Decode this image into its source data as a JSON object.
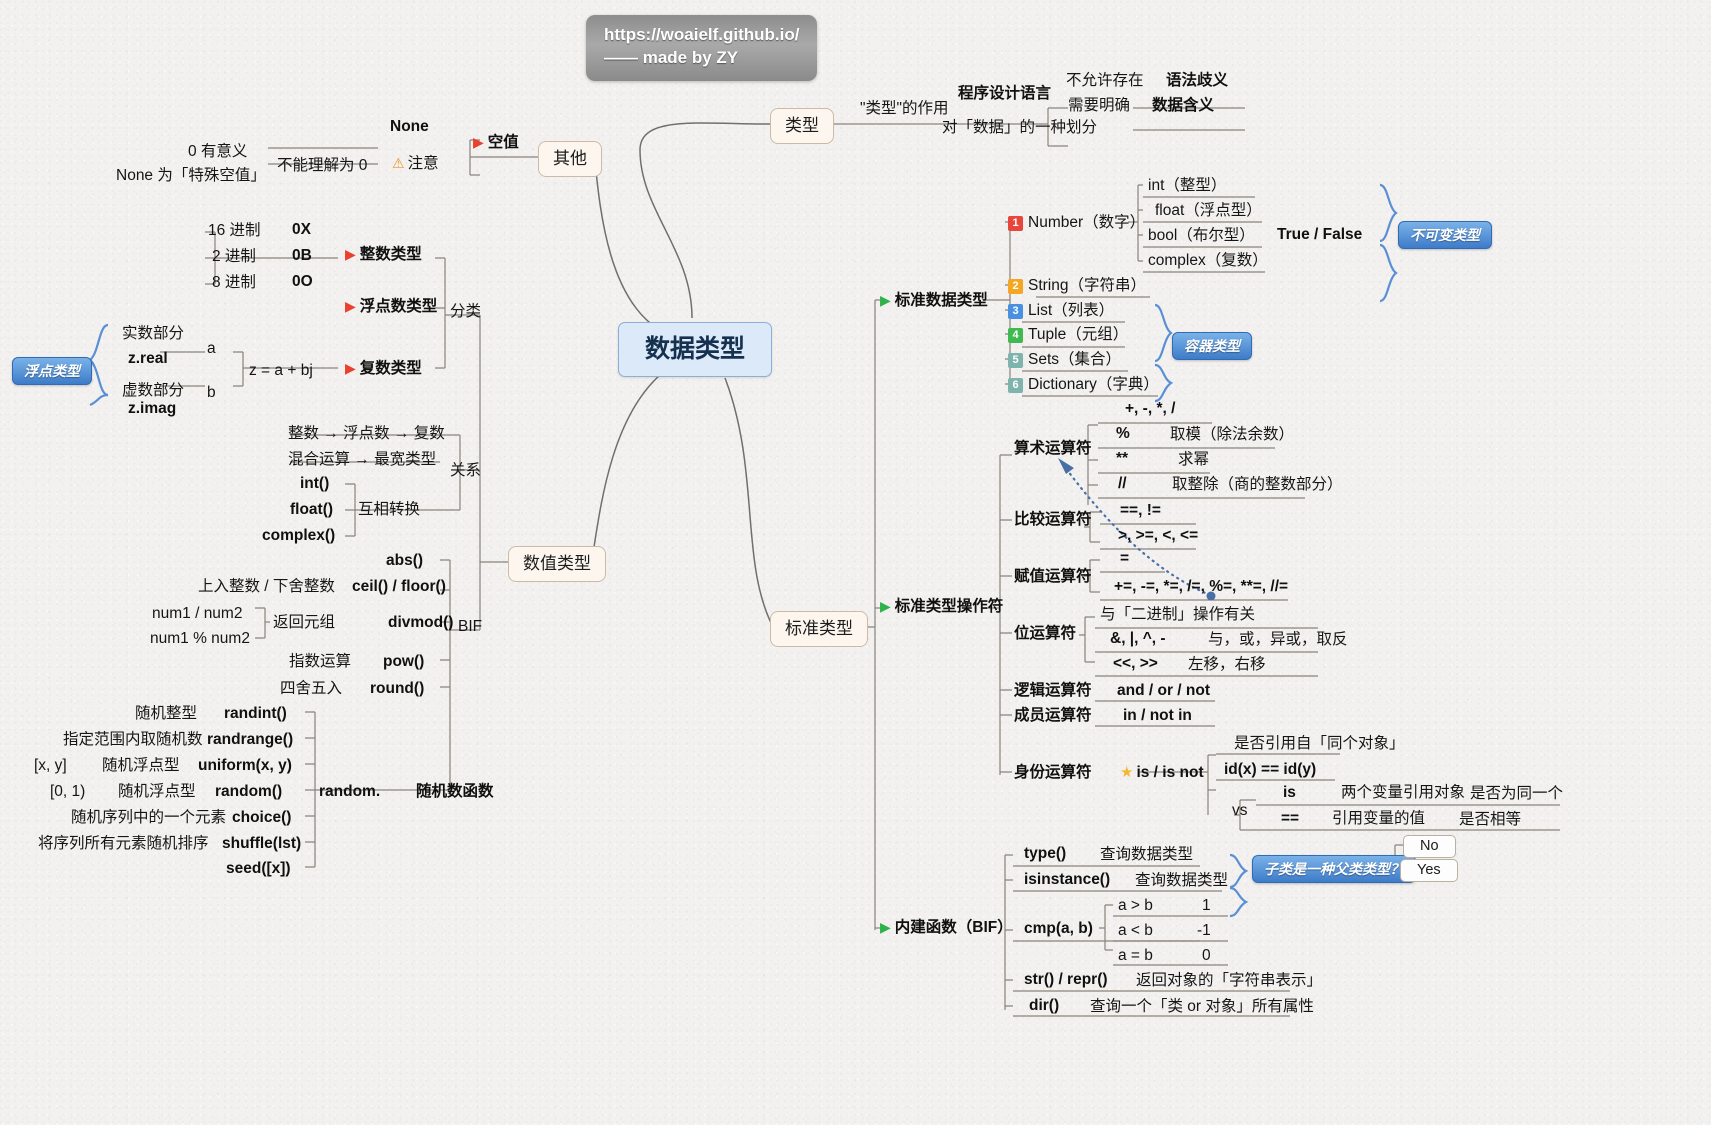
{
  "watermark": {
    "line1": "https://woaielf.github.io/",
    "line2": "—— made by ZY"
  },
  "root": {
    "label": "数据类型"
  },
  "branches": {
    "type": "类型",
    "other": "其他",
    "numeric": "数值类型",
    "standard": "标准类型"
  },
  "type_branch": {
    "role_label": "\"类型\"的作用",
    "lang_label": "程序设计语言",
    "division_label": "对「数据」的一种划分",
    "not_allowed": "不允许存在",
    "need_clear": "需要明确",
    "syntax_ambiguity": "语法歧义",
    "data_meaning": "数据含义"
  },
  "other_branch": {
    "empty_value": "空值",
    "none": "None",
    "cannot_be_zero": "不能理解为 0",
    "note": "注意",
    "zero_meaningful": "0 有意义",
    "none_special": "None 为「特殊空值」"
  },
  "numeric": {
    "classify": "分类",
    "relation": "关系",
    "bif": "BIF",
    "int_type": "整数类型",
    "float_type": "浮点数类型",
    "complex_type": "复数类型",
    "bases": [
      {
        "base": "16 进制",
        "prefix": "0X"
      },
      {
        "base": "2 进制",
        "prefix": "0B"
      },
      {
        "base": "8 进制",
        "prefix": "0O"
      }
    ],
    "float_pill": "浮点类型",
    "complex": {
      "real_label": "实数部分",
      "real_attr": "z.real",
      "imag_label": "虚数部分",
      "imag_attr": "z.imag",
      "a": "a",
      "b": "b",
      "formula": "z = a + bj"
    },
    "relations": [
      "整数 → 浮点数 → 复数",
      "混合运算 → 最宽类型"
    ],
    "convert_label": "互相转换",
    "convert_funcs": [
      "int()",
      "float()",
      "complex()"
    ],
    "bif_rows": [
      {
        "desc": "",
        "func": "abs()"
      },
      {
        "desc": "上入整数 / 下舍整数",
        "func": "ceil() / floor()"
      },
      {
        "desc": "返回元组",
        "func": "divmod()"
      },
      {
        "desc": "指数运算",
        "func": "pow()"
      },
      {
        "desc": "四舍五入",
        "func": "round()"
      }
    ],
    "divmod_args": [
      "num1 / num2",
      "num1 % num2"
    ],
    "random_label": "random.",
    "random_title": "随机数函数",
    "random_rows": [
      {
        "range": "",
        "desc": "随机整型",
        "func": "randint()"
      },
      {
        "range": "",
        "desc": "指定范围内取随机数",
        "func": "randrange()"
      },
      {
        "range": "[x, y]",
        "desc": "随机浮点型",
        "func": "uniform(x, y)"
      },
      {
        "range": "[0, 1)",
        "desc": "随机浮点型",
        "func": "random()"
      },
      {
        "range": "",
        "desc": "随机序列中的一个元素",
        "func": "choice()"
      },
      {
        "range": "",
        "desc": "将序列所有元素随机排序",
        "func": "shuffle(lst)"
      },
      {
        "range": "",
        "desc": "",
        "func": "seed([x])"
      }
    ]
  },
  "standard_types": {
    "std_data_types": "标准数据类型",
    "std_operators": "标准类型操作符",
    "builtin_funcs": "内建函数（BIF）",
    "data_types": [
      {
        "n": "1",
        "label": "Number（数字）"
      },
      {
        "n": "2",
        "label": "String（字符串）"
      },
      {
        "n": "3",
        "label": "List（列表）"
      },
      {
        "n": "4",
        "label": "Tuple（元组）"
      },
      {
        "n": "5",
        "label": "Sets（集合）"
      },
      {
        "n": "6",
        "label": "Dictionary（字典）"
      }
    ],
    "number_sub": [
      "int（整型）",
      "float（浮点型）",
      "bool（布尔型）",
      "complex（复数）"
    ],
    "bool_values": "True / False",
    "immutable_pill": "不可变类型",
    "container_pill": "容器类型"
  },
  "operators": {
    "arithmetic": {
      "name": "算术运算符",
      "top": "+, -, *, /",
      "rows": [
        {
          "op": "%",
          "desc": "取模（除法余数）"
        },
        {
          "op": "**",
          "desc": "求幂"
        },
        {
          "op": "//",
          "desc": "取整除（商的整数部分）"
        }
      ]
    },
    "comparison": {
      "name": "比较运算符",
      "top": "==, !=",
      "rows": [
        {
          "op": ">, >=, <, <=",
          "desc": ""
        }
      ]
    },
    "assignment": {
      "name": "赋值运算符",
      "top": "=",
      "rows": [
        {
          "op": "+=, -=, *=, /=, %=, **=, //=",
          "desc": ""
        }
      ]
    },
    "bitwise": {
      "name": "位运算符",
      "top": "与「二进制」操作有关",
      "rows": [
        {
          "op": "&, |, ^, -",
          "desc": "与，或，异或，取反"
        },
        {
          "op": "<<, >>",
          "desc": "左移，右移"
        }
      ]
    },
    "logical": {
      "name": "逻辑运算符",
      "value": "and / or / not"
    },
    "membership": {
      "name": "成员运算符",
      "value": "in / not in"
    },
    "identity": {
      "name": "身份运算符",
      "value": "is / is not",
      "same_object": "是否引用自「同个对象」",
      "id_expr": "id(x) == id(y)",
      "vs": "vs",
      "is_label": "is",
      "is_desc": "两个变量引用对象",
      "is_result": "是否为同一个",
      "eq_label": "==",
      "eq_desc": "引用变量的值",
      "eq_result": "是否相等"
    }
  },
  "bif_section": {
    "rows": [
      {
        "func": "type()",
        "desc": "查询数据类型"
      },
      {
        "func": "isinstance()",
        "desc": "查询数据类型"
      },
      {
        "func": "cmp(a, b)",
        "desc": ""
      },
      {
        "func": "str() / repr()",
        "desc": "返回对象的「字符串表示」"
      },
      {
        "func": "dir()",
        "desc": "查询一个「类 or 对象」所有属性"
      }
    ],
    "cmp_rows": [
      {
        "cond": "a > b",
        "val": "1"
      },
      {
        "cond": "a < b",
        "val": "-1"
      },
      {
        "cond": "a = b",
        "val": "0"
      }
    ],
    "subclass_pill": "子类是一种父类类型？",
    "no": "No",
    "yes": "Yes"
  }
}
